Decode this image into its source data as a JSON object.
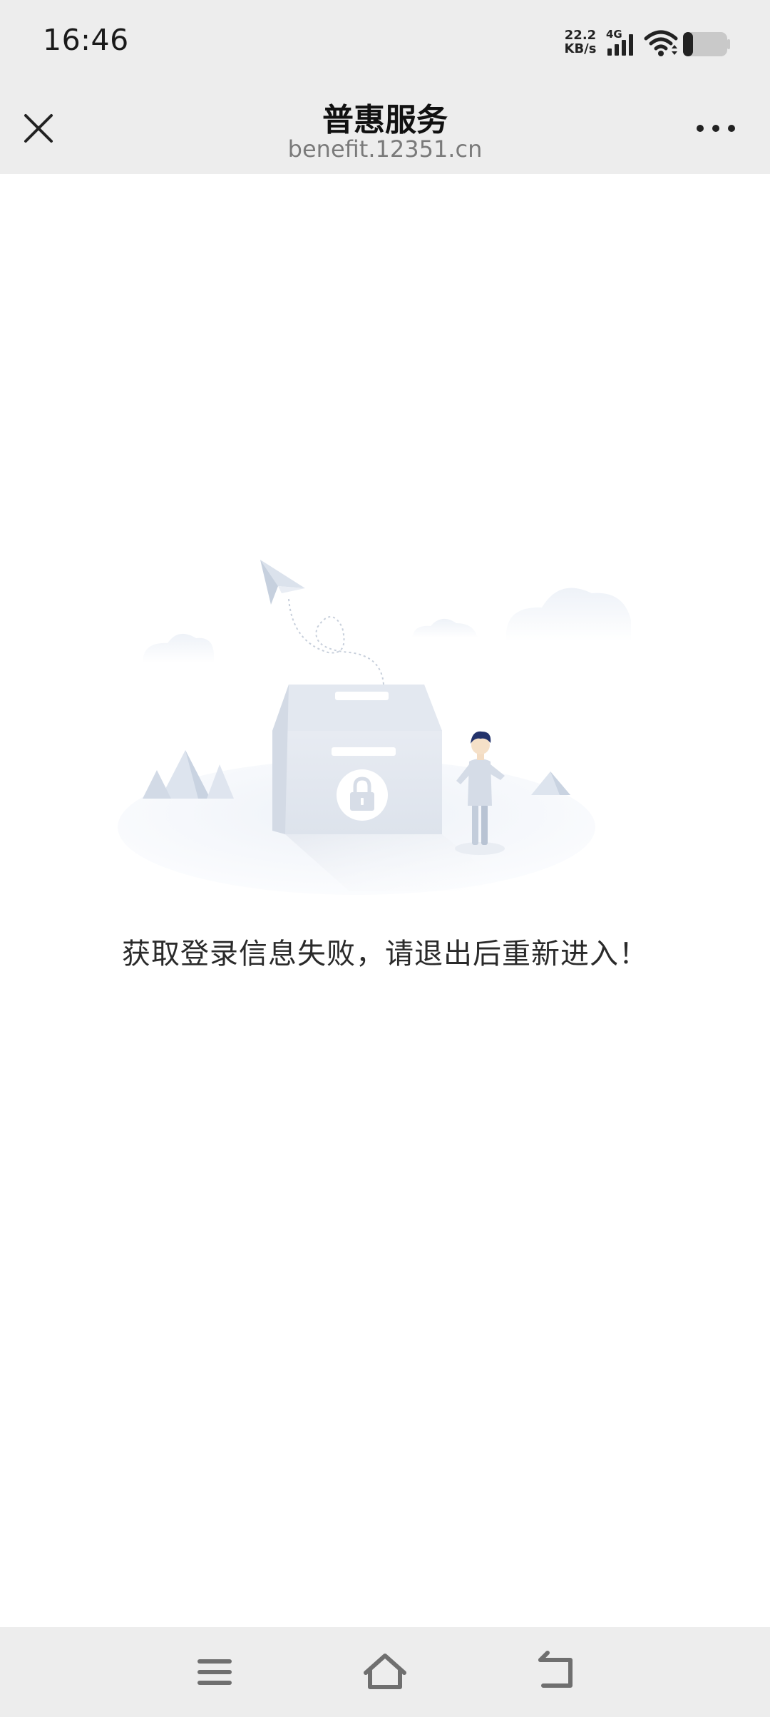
{
  "status_bar": {
    "time": "16:46",
    "net_speed_value": "22.2",
    "net_speed_unit": "KB/s",
    "network_type": "4G",
    "icons": [
      "signal-icon",
      "wifi-icon",
      "battery-icon"
    ]
  },
  "title_bar": {
    "title": "普惠服务",
    "domain": "benefit.12351.cn",
    "icons": [
      "close-icon",
      "more-icon"
    ]
  },
  "main": {
    "error_message": "获取登录信息失败，请退出后重新进入！",
    "illustration": "locked-box-illustration"
  },
  "nav_bar": {
    "icons": [
      "menu-icon",
      "home-icon",
      "back-icon"
    ]
  },
  "colors": {
    "bar_background": "#ededed",
    "page_background": "#ffffff",
    "text_primary": "#111111",
    "text_secondary": "#7a7a7a"
  }
}
